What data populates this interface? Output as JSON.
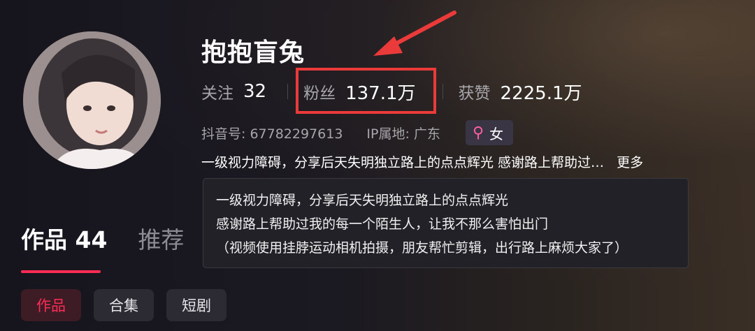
{
  "profile": {
    "name": "抱抱盲兔",
    "stats": {
      "following_label": "关注",
      "following_value": "32",
      "followers_label": "粉丝",
      "followers_value": "137.1万",
      "likes_label": "获赞",
      "likes_value": "2225.1万"
    },
    "meta": {
      "douyin_id": "抖音号: 67782297613",
      "ip": "IP属地: 广东",
      "gender": "女"
    },
    "bio_preview": "一级视力障碍，分享后天失明独立路上的点点辉光 感谢路上帮助过…",
    "bio_more": "更多",
    "bio_full": [
      "一级视力障碍，分享后天失明独立路上的点点辉光",
      "感谢路上帮助过我的每一个陌生人，让我不那么害怕出门",
      "（视频使用挂脖运动相机拍摄，朋友帮忙剪辑，出行路上麻烦大家了）"
    ]
  },
  "tabs": [
    {
      "label": "作品 44",
      "active": true
    },
    {
      "label": "推荐",
      "active": false
    }
  ],
  "filters": [
    {
      "label": "作品",
      "active": true
    },
    {
      "label": "合集",
      "active": false
    },
    {
      "label": "短剧",
      "active": false
    }
  ],
  "colors": {
    "accent": "#fe2c55",
    "annotation": "#ea3a3a",
    "background": "#17161f"
  },
  "icons": [
    "female-icon",
    "annotation-arrow-icon"
  ]
}
